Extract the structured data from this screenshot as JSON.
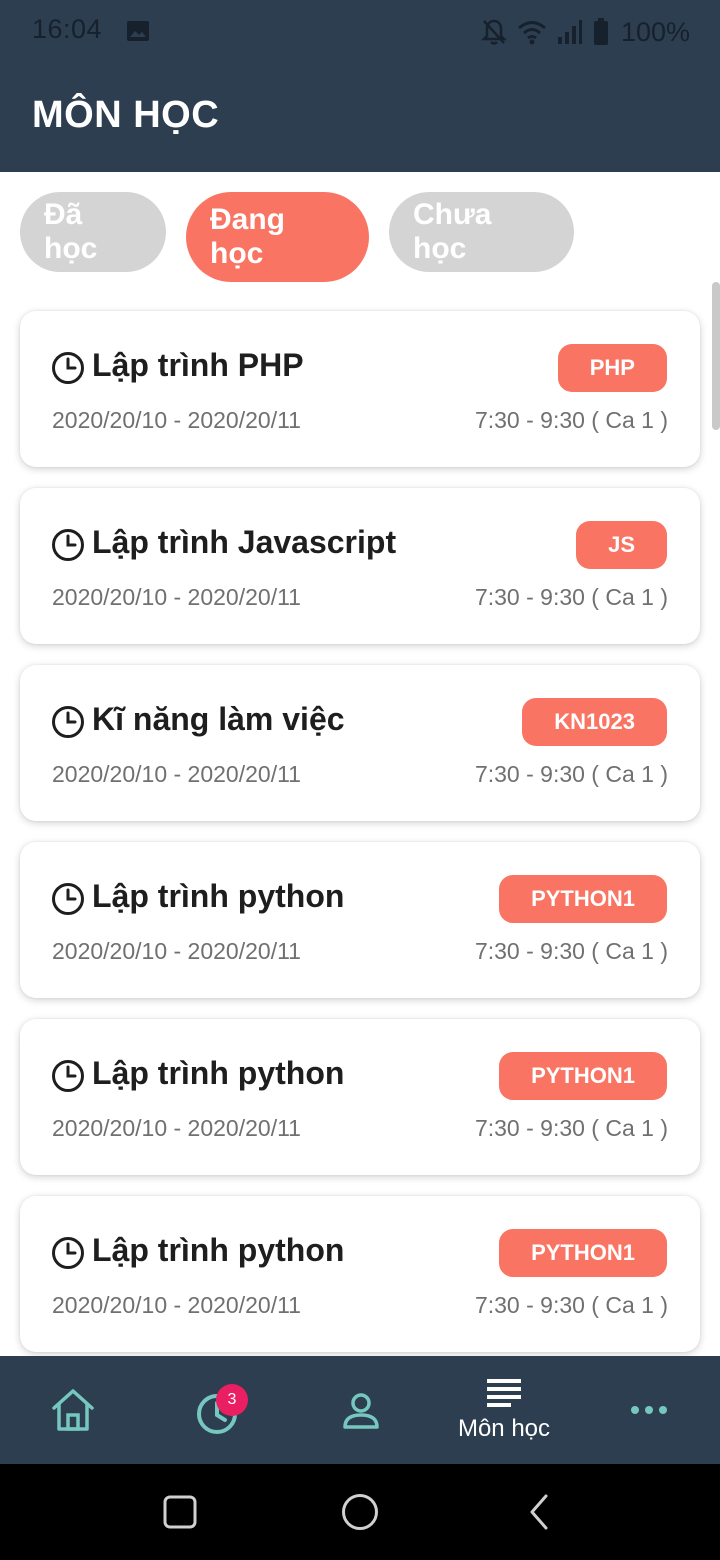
{
  "status_bar": {
    "time": "16:04",
    "battery": "100%",
    "icons": [
      "image-icon",
      "bell-off-icon",
      "wifi-icon",
      "signal-icon",
      "battery-icon"
    ]
  },
  "header": {
    "title": "MÔN HỌC"
  },
  "tabs": [
    {
      "label": "Đã học",
      "active": false
    },
    {
      "label": "Đang học",
      "active": true
    },
    {
      "label": "Chưa học",
      "active": false
    }
  ],
  "courses": [
    {
      "name": "Lập trình PHP",
      "code": "PHP",
      "dates": "2020/20/10 - 2020/20/11",
      "time": "7:30 - 9:30 ( Ca 1 )"
    },
    {
      "name": "Lập trình Javascript",
      "code": "JS",
      "dates": "2020/20/10 - 2020/20/11",
      "time": "7:30 - 9:30 ( Ca 1 )"
    },
    {
      "name": "Kĩ năng làm việc",
      "code": "KN1023",
      "dates": "2020/20/10 - 2020/20/11",
      "time": "7:30 - 9:30 ( Ca 1 )"
    },
    {
      "name": "Lập trình python",
      "code": "PYTHON1",
      "dates": "2020/20/10 - 2020/20/11",
      "time": "7:30 - 9:30 ( Ca 1 )"
    },
    {
      "name": "Lập trình python",
      "code": "PYTHON1",
      "dates": "2020/20/10 - 2020/20/11",
      "time": "7:30 - 9:30 ( Ca 1 )"
    },
    {
      "name": "Lập trình python",
      "code": "PYTHON1",
      "dates": "2020/20/10 - 2020/20/11",
      "time": "7:30 - 9:30 ( Ca 1 )"
    }
  ],
  "bottom_nav": {
    "history_badge": "3",
    "courses_label": "Môn học",
    "items": [
      "home-icon",
      "history-icon",
      "profile-icon",
      "courses-icon",
      "more-icon"
    ]
  },
  "colors": {
    "header_bg": "#2c3e50",
    "accent": "#f97462",
    "inactive_tab": "#d4d4d4",
    "badge": "#e91e63",
    "nav_icon": "#76c7c0"
  }
}
